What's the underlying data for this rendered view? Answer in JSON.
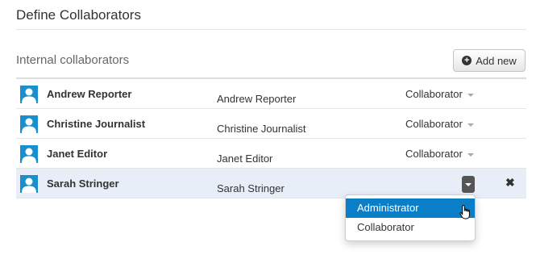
{
  "header": {
    "title": "Define Collaborators"
  },
  "section": {
    "title": "Internal collaborators",
    "add_label": "Add new"
  },
  "collaborators": [
    {
      "display_name": "Andrew Reporter",
      "name": "Andrew Reporter",
      "role": "Collaborator"
    },
    {
      "display_name": "Christine Journalist",
      "name": "Christine Journalist",
      "role": "Collaborator"
    },
    {
      "display_name": "Janet Editor",
      "name": "Janet Editor",
      "role": "Collaborator"
    },
    {
      "display_name": "Sarah Stringer",
      "name": "Sarah Stringer",
      "role": ""
    }
  ],
  "role_menu": {
    "options": [
      "Administrator",
      "Collaborator"
    ],
    "highlighted": "Administrator"
  },
  "colors": {
    "avatar": "#1a8fce",
    "selected_row": "#e8eef8",
    "menu_highlight": "#0a7fc7"
  },
  "icons": {
    "avatar": "user-avatar-icon",
    "add": "plus-circle-icon",
    "remove": "close-icon",
    "dropdown": "caret-down-icon",
    "cursor": "hand-pointer-icon"
  }
}
